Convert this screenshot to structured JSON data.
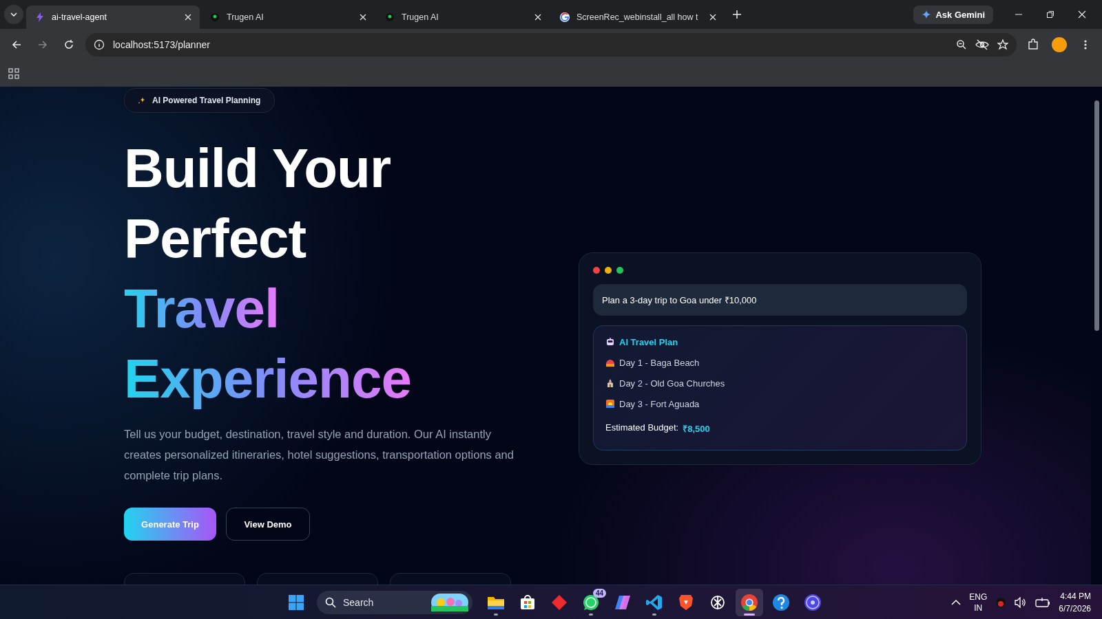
{
  "browser": {
    "tabs": [
      {
        "title": "ai-travel-agent",
        "kind": "bolt",
        "selected": true
      },
      {
        "title": "Trugen AI",
        "kind": "dot",
        "selected": false
      },
      {
        "title": "Trugen AI",
        "kind": "dot",
        "selected": false
      },
      {
        "title": "ScreenRec_webinstall_all how t",
        "kind": "google",
        "selected": false
      }
    ],
    "ask_label": "Ask Gemini",
    "address": "localhost:5173/planner"
  },
  "hero": {
    "badge": "AI Powered Travel Planning",
    "headline": [
      {
        "text": "Build Your",
        "kind": "plain"
      },
      {
        "text": "Perfect",
        "kind": "plain"
      },
      {
        "text": "Travel",
        "kind": "gradient"
      },
      {
        "text": "Experience",
        "kind": "gradient"
      }
    ],
    "description": "Tell us your budget, destination, travel style and duration. Our AI instantly creates personalized itineraries, hotel suggestions, transportation options and complete trip plans.",
    "buttons": [
      {
        "label": "Generate Trip",
        "kind": "primary"
      },
      {
        "label": "View Demo",
        "kind": "secondary"
      }
    ]
  },
  "preview": {
    "prompt": "Plan a 3-day trip to Goa under ₹10,000",
    "plan_title": "AI Travel Plan",
    "days": [
      {
        "text": "Day 1 - Baga Beach",
        "kind": "beach"
      },
      {
        "text": "Day 2 - Old Goa Churches",
        "kind": "church"
      },
      {
        "text": "Day 3 - Fort Aguada",
        "kind": "sunset"
      }
    ],
    "budget_label": "Estimated Budget:",
    "budget_value": "₹8,500"
  },
  "taskbar": {
    "search_placeholder": "Search",
    "apps": [
      {
        "kind": "explorer",
        "running": true,
        "selected": false
      },
      {
        "kind": "store",
        "running": false,
        "selected": false
      },
      {
        "kind": "diamond",
        "running": false,
        "selected": false
      },
      {
        "kind": "whatsapp",
        "running": true,
        "selected": false,
        "badge": "44"
      },
      {
        "kind": "copilot",
        "running": false,
        "selected": false
      },
      {
        "kind": "vscode",
        "running": true,
        "selected": false
      },
      {
        "kind": "brave",
        "running": false,
        "selected": false
      },
      {
        "kind": "chatgpt",
        "running": false,
        "selected": false
      },
      {
        "kind": "chrome",
        "running": true,
        "selected": true
      },
      {
        "kind": "help",
        "running": false,
        "selected": false
      },
      {
        "kind": "cd",
        "running": false,
        "selected": false
      }
    ],
    "language": "ENG",
    "region": "IN",
    "time": "4:44 PM",
    "date": "6/7/2026"
  }
}
